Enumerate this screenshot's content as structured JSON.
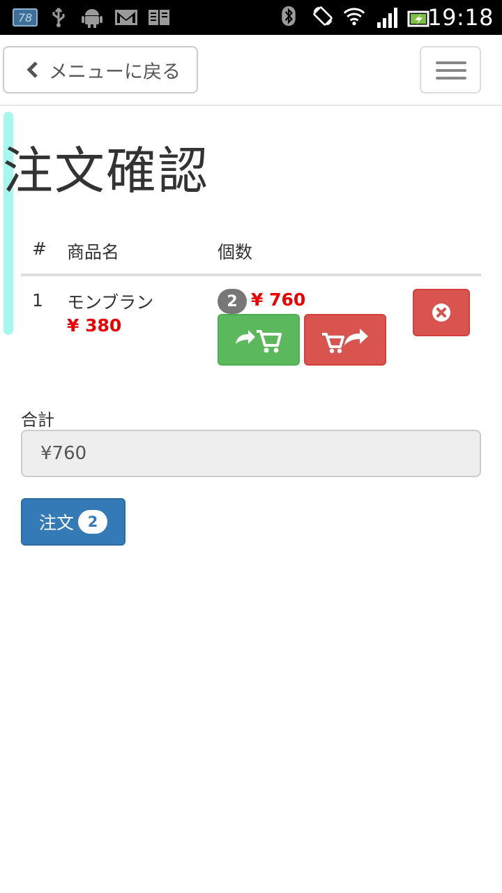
{
  "status_bar": {
    "time": "19:18",
    "notification_badge": "78",
    "icons": [
      "notification-78-icon",
      "usb-icon",
      "android-icon",
      "gmail-icon",
      "reader-icon",
      "bluetooth-icon",
      "rotate-icon",
      "wifi-icon",
      "signal-icon",
      "battery-charging-icon"
    ]
  },
  "navbar": {
    "back_label": "メニューに戻る",
    "back_icon": "chevron-left-icon",
    "menu_icon": "hamburger-menu-icon"
  },
  "page": {
    "title": "注文確認"
  },
  "table": {
    "headers": [
      "#",
      "商品名",
      "個数"
    ],
    "rows": [
      {
        "num": "1",
        "name": "モンブラン",
        "price": "¥ 380",
        "qty": "2",
        "subtotal": "¥ 760",
        "add_icon": "add-to-cart-icon",
        "remove_icon": "remove-from-cart-icon",
        "delete_icon": "remove-circle-icon"
      }
    ]
  },
  "total": {
    "label": "合計",
    "value": "¥760"
  },
  "order": {
    "label": "注文",
    "count": "2"
  },
  "colors": {
    "price_red": "#ee0000",
    "success_green": "#5cb85c",
    "danger_red": "#d9534f",
    "primary_blue": "#337ab7",
    "accent_cyan": "#a6f7ee"
  }
}
